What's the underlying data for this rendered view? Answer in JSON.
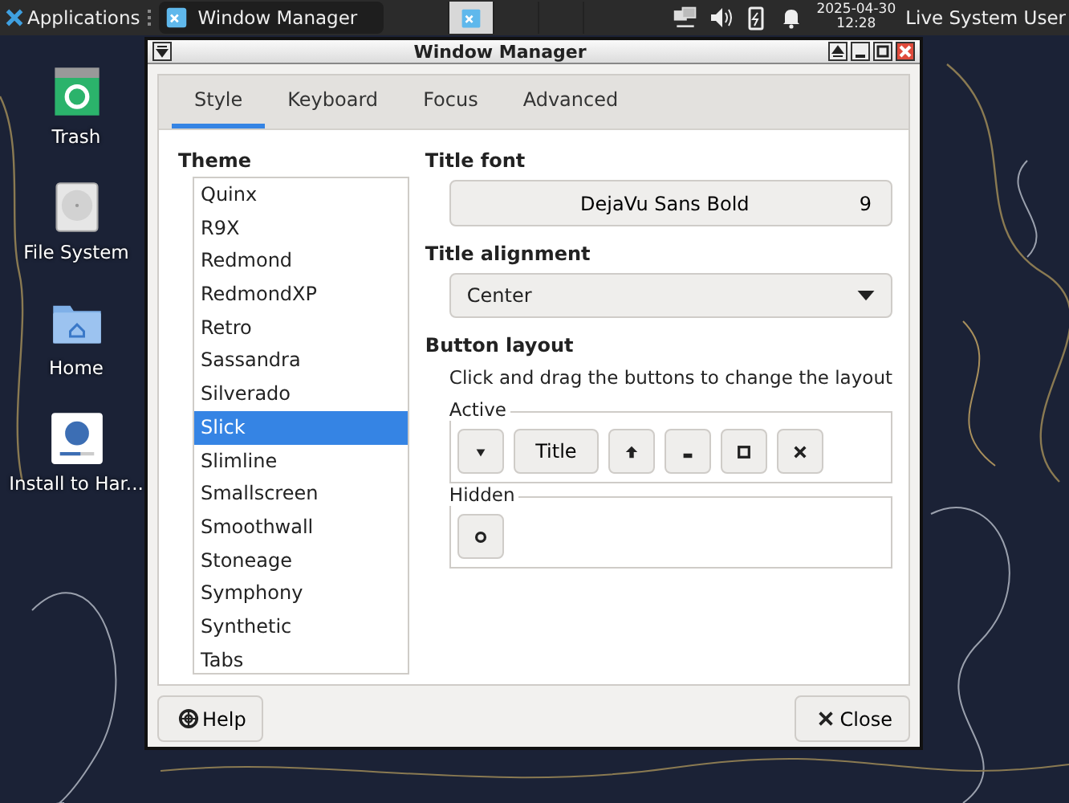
{
  "panel": {
    "apps_menu": "Applications",
    "tasks": [
      {
        "label": "Window Manager",
        "selected": true
      }
    ],
    "date": "2025-04-30",
    "time": "12:28",
    "user": "Live System User"
  },
  "desktop_icons": [
    {
      "kind": "trash",
      "label": "Trash"
    },
    {
      "kind": "drive",
      "label": "File System"
    },
    {
      "kind": "home",
      "label": "Home"
    },
    {
      "kind": "installer",
      "label": "Install to Har..."
    }
  ],
  "window": {
    "title": "Window Manager",
    "tabs": [
      {
        "label": "Style",
        "selected": true
      },
      {
        "label": "Keyboard",
        "selected": false
      },
      {
        "label": "Focus",
        "selected": false
      },
      {
        "label": "Advanced",
        "selected": false
      }
    ],
    "theme": {
      "label": "Theme",
      "items": [
        {
          "label": "Quinx",
          "selected": false
        },
        {
          "label": "R9X",
          "selected": false
        },
        {
          "label": "Redmond",
          "selected": false
        },
        {
          "label": "RedmondXP",
          "selected": false
        },
        {
          "label": "Retro",
          "selected": false
        },
        {
          "label": "Sassandra",
          "selected": false
        },
        {
          "label": "Silverado",
          "selected": false
        },
        {
          "label": "Slick",
          "selected": true
        },
        {
          "label": "Slimline",
          "selected": false
        },
        {
          "label": "Smallscreen",
          "selected": false
        },
        {
          "label": "Smoothwall",
          "selected": false
        },
        {
          "label": "Stoneage",
          "selected": false
        },
        {
          "label": "Symphony",
          "selected": false
        },
        {
          "label": "Synthetic",
          "selected": false
        },
        {
          "label": "Tabs",
          "selected": false
        }
      ]
    },
    "title_font": {
      "label": "Title font",
      "font": "DejaVu Sans Bold",
      "size": "9"
    },
    "title_alignment": {
      "label": "Title alignment",
      "value": "Center"
    },
    "button_layout": {
      "label": "Button layout",
      "hint": "Click and drag the buttons to change the layout",
      "active": {
        "label": "Active",
        "buttons": [
          {
            "kind": "menu"
          },
          {
            "kind": "title",
            "label": "Title"
          },
          {
            "kind": "shade"
          },
          {
            "kind": "minimize"
          },
          {
            "kind": "maximize"
          },
          {
            "kind": "close"
          }
        ]
      },
      "hidden": {
        "label": "Hidden",
        "buttons": [
          {
            "kind": "stick"
          }
        ]
      }
    },
    "buttons": [
      {
        "kind": "help",
        "label": "Help"
      },
      {
        "kind": "close",
        "label": "Close"
      }
    ]
  }
}
